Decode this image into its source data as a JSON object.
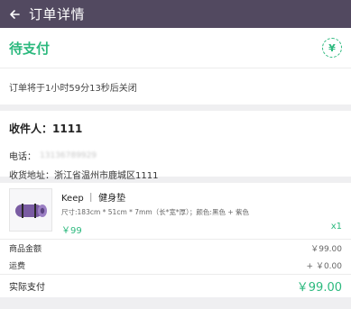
{
  "header": {
    "back_icon": "arrow-left-icon",
    "title": "订单详情"
  },
  "order": {
    "status": "待支付",
    "status_icon": "yen-icon",
    "status_icon_glyph": "¥",
    "notice": "订单将于1小时59分13秒后关闭",
    "accent_color": "#2cb97e"
  },
  "address": {
    "receiver": "收件人：1111",
    "phone_label": "电话：",
    "phone_value": "13136789929",
    "address_line": "收货地址：浙江省温州市鹿城区1111"
  },
  "product": {
    "name": "Keep ｜ 健身垫",
    "spec": "尺寸:183cm * 51cm * 7mm（长*宽*厚）；颜色:黑色 + 紫色",
    "price": "￥99",
    "quantity": "x1",
    "image_icon": "yoga-mat-image"
  },
  "summary": {
    "subtotal_label": "商品金额",
    "subtotal_value": "￥99.00",
    "shipping_label": "运费",
    "shipping_value": "+ ￥0.00",
    "total_label": "实际支付",
    "total_value": "￥99.00"
  }
}
